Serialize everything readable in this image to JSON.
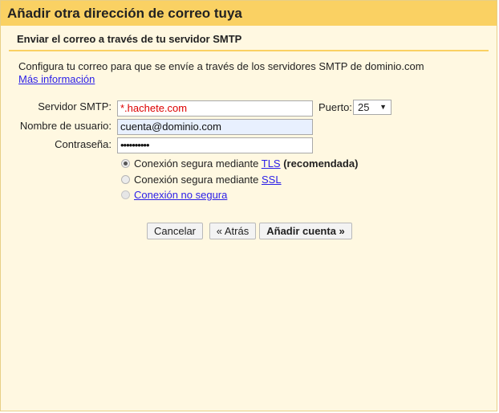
{
  "dialog": {
    "title": "Añadir otra dirección de correo tuya",
    "subtitle": "Enviar el correo a través de tu servidor SMTP",
    "description": "Configura tu correo para que se envíe a través de los servidores SMTP de dominio.com",
    "more_info_link": "Más información"
  },
  "form": {
    "smtp_label": "Servidor SMTP:",
    "smtp_value": "*.hachete.com",
    "port_label": "Puerto:",
    "port_value": "25",
    "username_label": "Nombre de usuario:",
    "username_value": "cuenta@dominio.com",
    "password_label": "Contraseña:",
    "password_value": "••••••••••"
  },
  "security": {
    "tls_prefix": "Conexión segura mediante ",
    "tls_link": "TLS",
    "tls_suffix": " (recomendada)",
    "ssl_prefix": "Conexión segura mediante ",
    "ssl_link": "SSL",
    "insecure_link": "Conexión no segura",
    "selected": "TLS"
  },
  "buttons": {
    "cancel": "Cancelar",
    "back": "« Atrás",
    "add_account": "Añadir cuenta »"
  },
  "colors": {
    "title_bar": "#fad163",
    "dialog_background": "#fff8e1",
    "link": "#2a1ee8",
    "error_text": "#d00000"
  }
}
